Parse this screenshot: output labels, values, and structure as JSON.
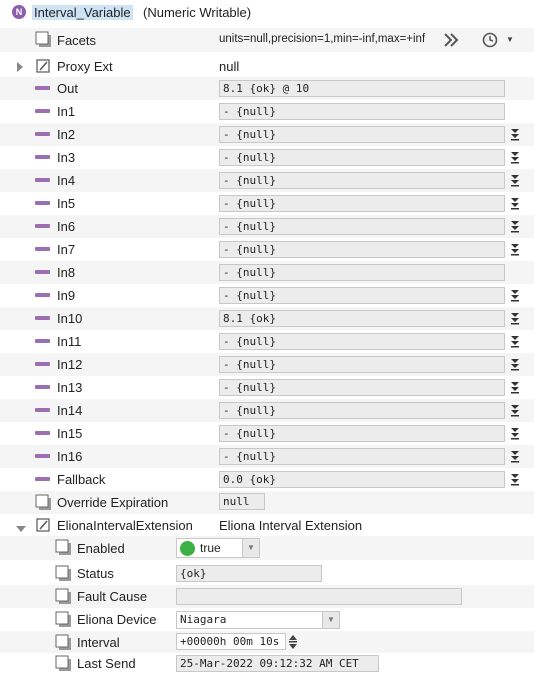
{
  "header": {
    "badge": "N",
    "name": "Interval_Variable",
    "type": "(Numeric Writable)"
  },
  "facets": {
    "label": "Facets",
    "value": "units=null,precision=1,min=-inf,max=+inf"
  },
  "proxy_ext": {
    "label": "Proxy Ext",
    "value": "null"
  },
  "slots": [
    {
      "label": "Out",
      "value": "8.1 {ok} @ 10",
      "dropdown": false
    },
    {
      "label": "In1",
      "value": "- {null}",
      "dropdown": false
    },
    {
      "label": "In2",
      "value": "- {null}",
      "dropdown": true
    },
    {
      "label": "In3",
      "value": "- {null}",
      "dropdown": true
    },
    {
      "label": "In4",
      "value": "- {null}",
      "dropdown": true
    },
    {
      "label": "In5",
      "value": "- {null}",
      "dropdown": true
    },
    {
      "label": "In6",
      "value": "- {null}",
      "dropdown": true
    },
    {
      "label": "In7",
      "value": "- {null}",
      "dropdown": true
    },
    {
      "label": "In8",
      "value": "- {null}",
      "dropdown": false
    },
    {
      "label": "In9",
      "value": "- {null}",
      "dropdown": true
    },
    {
      "label": "In10",
      "value": "8.1 {ok}",
      "dropdown": true
    },
    {
      "label": "In11",
      "value": "- {null}",
      "dropdown": true
    },
    {
      "label": "In12",
      "value": "- {null}",
      "dropdown": true
    },
    {
      "label": "In13",
      "value": "- {null}",
      "dropdown": true
    },
    {
      "label": "In14",
      "value": "- {null}",
      "dropdown": true
    },
    {
      "label": "In15",
      "value": "- {null}",
      "dropdown": true
    },
    {
      "label": "In16",
      "value": "- {null}",
      "dropdown": true
    },
    {
      "label": "Fallback",
      "value": "0.0 {ok}",
      "dropdown": true
    }
  ],
  "override_expiration": {
    "label": "Override Expiration",
    "value": "null"
  },
  "extension": {
    "label": "ElionaIntervalExtension",
    "value": "Eliona Interval Extension",
    "enabled": {
      "label": "Enabled",
      "value": "true",
      "status_color": "#3cb043"
    },
    "status": {
      "label": "Status",
      "value": "{ok}"
    },
    "fault_cause": {
      "label": "Fault Cause",
      "value": ""
    },
    "device": {
      "label": "Eliona Device",
      "value": "Niagara"
    },
    "interval": {
      "label": "Interval",
      "value": "+00000h 00m 10s"
    },
    "last_send": {
      "label": "Last Send",
      "value": "25-Mar-2022 09:12:32 AM CET"
    }
  },
  "colors": {
    "slot_dash": "#9b6fb0",
    "badge": "#8e5bb0",
    "enabled_dot": "#3cb043"
  }
}
